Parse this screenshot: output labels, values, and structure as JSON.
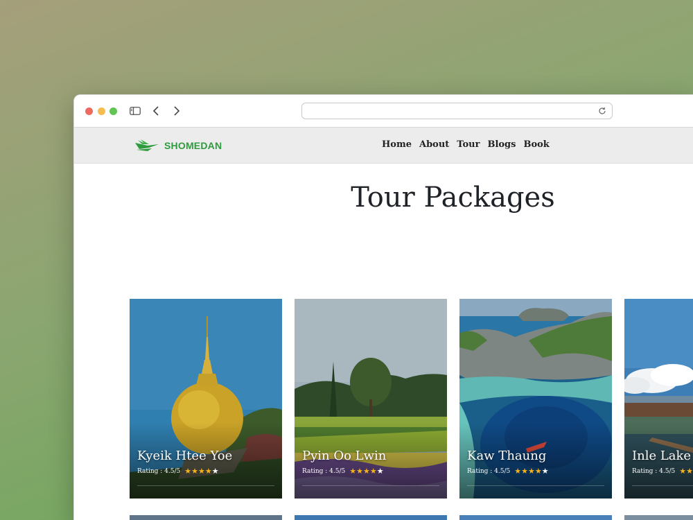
{
  "browser": {
    "address_value": ""
  },
  "site": {
    "logo_text": "SHOMEDAN",
    "nav": [
      "Home",
      "About",
      "Tour",
      "Blogs",
      "Book"
    ]
  },
  "page": {
    "title": "Tour Packages"
  },
  "packages": [
    {
      "name": "Kyeik Htee Yoe",
      "rating_text": "Rating : 4.5/5",
      "rating": 4.5
    },
    {
      "name": "Pyin Oo Lwin",
      "rating_text": "Rating : 4.5/5",
      "rating": 4.5
    },
    {
      "name": "Kaw Thaung",
      "rating_text": "Rating : 4.5/5",
      "rating": 4.5
    },
    {
      "name": "Inle Lake",
      "rating_text": "Rating : 4.5/5",
      "rating": 4.5
    }
  ],
  "colors": {
    "brand_green": "#2e9c3e",
    "star": "#f6b21c"
  }
}
